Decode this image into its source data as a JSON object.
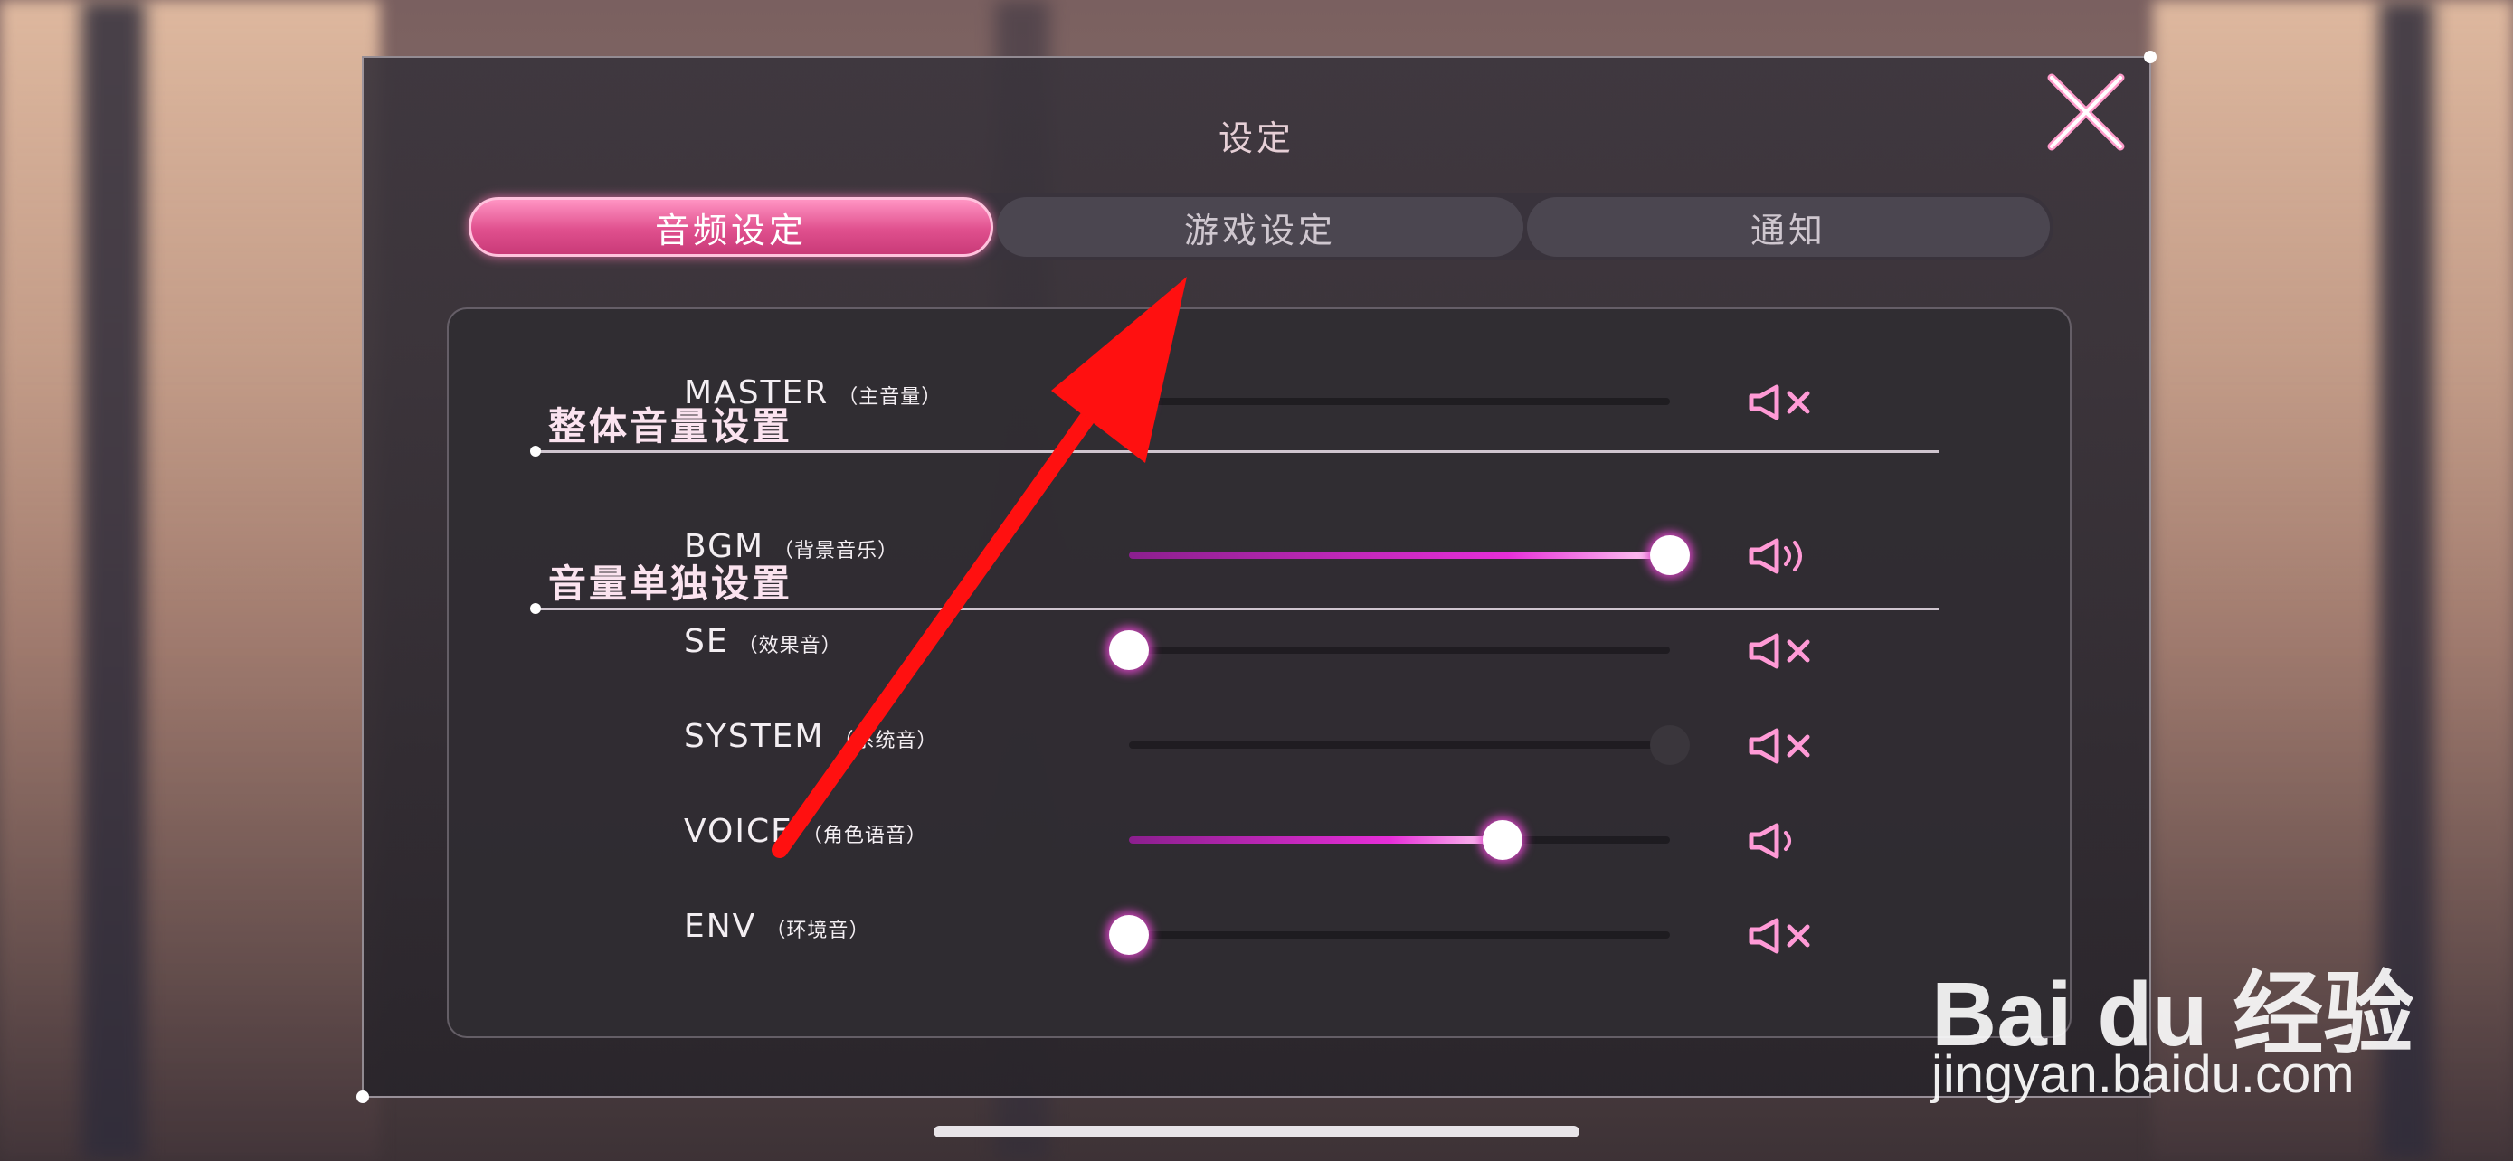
{
  "dialog": {
    "title": "设定",
    "close_icon": "close-x-icon"
  },
  "tabs": [
    {
      "label": "音频设定",
      "active": true
    },
    {
      "label": "游戏设定",
      "active": false
    },
    {
      "label": "通知",
      "active": false
    }
  ],
  "sections": {
    "overall": "整体音量设置",
    "individual": "音量单独设置"
  },
  "volume_rows": [
    {
      "label": "MASTER",
      "sub": "（主音量）",
      "value": 0.0,
      "muted": true,
      "enabled": true
    },
    {
      "label": "BGM",
      "sub": "（背景音乐）",
      "value": 1.0,
      "muted": false,
      "enabled": true
    },
    {
      "label": "SE",
      "sub": "（效果音）",
      "value": 0.0,
      "muted": true,
      "enabled": true
    },
    {
      "label": "SYSTEM",
      "sub": "（系统音）",
      "value": 1.0,
      "muted": true,
      "enabled": false
    },
    {
      "label": "VOICE",
      "sub": "（角色语音）",
      "value": 0.69,
      "muted": false,
      "enabled": true
    },
    {
      "label": "ENV",
      "sub": "（环境音）",
      "value": 0.0,
      "muted": true,
      "enabled": true
    }
  ],
  "watermark": {
    "logo": "Bai du 经验",
    "url": "jingyan.baidu.com"
  },
  "colors": {
    "accent_pink": "#e0508e",
    "slider_fill": "#e62ed8",
    "annotation_arrow": "#ff1010"
  }
}
